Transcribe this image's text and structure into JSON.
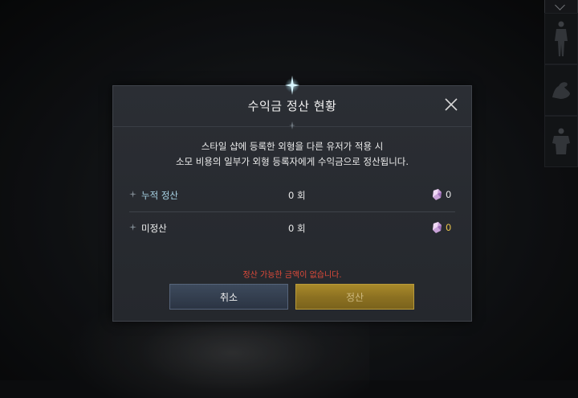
{
  "modal": {
    "title": "수익금 정산 현황",
    "description_line1": "스타일 샵에 등록한 외형을 다른 유저가 적용 시",
    "description_line2": "소모 비용의 일부가 외형 등록자에게 수익금으로 정산됩니다.",
    "rows": [
      {
        "label": "누적 정산",
        "count": "0 회",
        "value": "0",
        "label_color": "#a9d4e6",
        "value_color": "#e8e8e8"
      },
      {
        "label": "미정산",
        "count": "0 회",
        "value": "0",
        "label_color": "#f0f0f0",
        "value_color": "#e8c24a"
      }
    ],
    "warning": "정산 가능한 금액이 없습니다.",
    "cancel_label": "취소",
    "settle_label": "정산",
    "settle_enabled": false
  },
  "side_panel": {
    "slots": [
      "body-icon",
      "arm-icon",
      "torso-icon"
    ]
  }
}
